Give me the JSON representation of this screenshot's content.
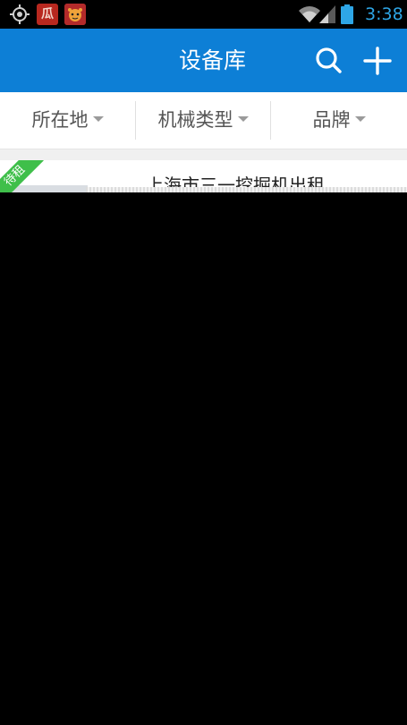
{
  "status_bar": {
    "time": "3:38",
    "app_icon_label": "瓜",
    "icons": [
      "gps-icon",
      "app-icon-gua",
      "app-icon-tiger",
      "wifi-icon",
      "signal-icon",
      "battery-icon"
    ],
    "clock_color": "#2ea6e6"
  },
  "header": {
    "title": "设备库",
    "background": "#0d7fd6",
    "actions": [
      "search-icon",
      "plus-icon"
    ]
  },
  "filters": [
    {
      "label": "所在地",
      "icon": "caret-down-icon"
    },
    {
      "label": "机械类型",
      "icon": "caret-down-icon"
    },
    {
      "label": "品牌",
      "icon": "caret-down-icon"
    }
  ],
  "listings": [
    {
      "status": "待租",
      "status_color": "#3fbf4a",
      "title": "上海市三一挖掘机出租"
    }
  ]
}
